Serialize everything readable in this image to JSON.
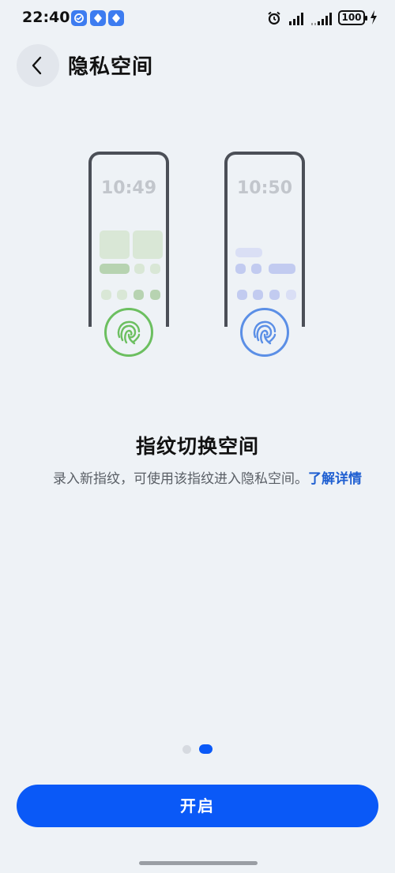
{
  "status_bar": {
    "time": "22:40",
    "notification_icons": [
      "app-notification-icon",
      "shield-notification-icon",
      "shield-notification-icon"
    ],
    "battery": "100",
    "icons": [
      "alarm-icon",
      "signal-icon",
      "signal-icon",
      "charging-icon"
    ]
  },
  "header": {
    "back_icon": "chevron-left-icon",
    "title": "隐私空间"
  },
  "illustration": {
    "left_phone_time": "10:49",
    "right_phone_time": "10:50",
    "left_accent": "#6cbf60",
    "right_accent": "#5b8fe6"
  },
  "content": {
    "title": "指纹切换空间",
    "description": "录入新指纹，可使用该指纹进入隐私空间。",
    "learn_more": "了解详情"
  },
  "pager": {
    "current_page": 2,
    "total_pages": 2
  },
  "action": {
    "enable_label": "开启"
  },
  "colors": {
    "primary": "#0a59f7",
    "background": "#eef2f6"
  }
}
